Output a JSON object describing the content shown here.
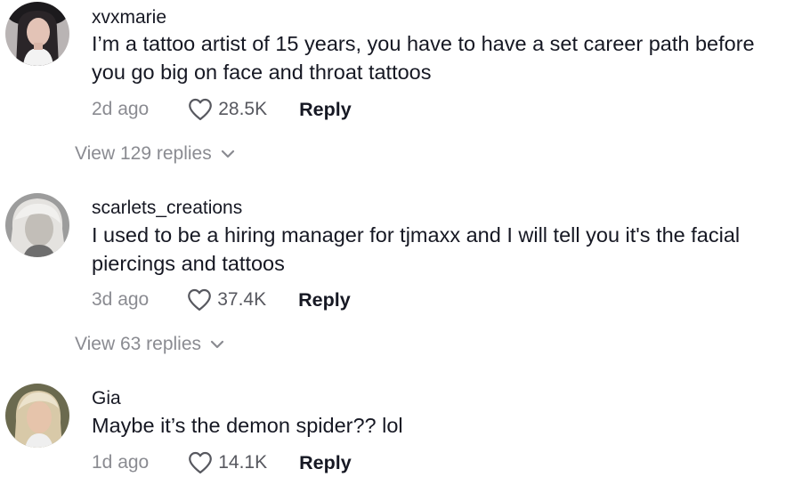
{
  "comments": [
    {
      "username": "xvxmarie",
      "text": "I’m a tattoo artist of 15 years, you have to have a set career path before you go big on face and throat tattoos",
      "time": "2d ago",
      "likes": "28.5K",
      "reply_label": "Reply",
      "view_replies": "View 129 replies"
    },
    {
      "username": "scarlets_creations",
      "text": "I used to be a hiring manager for tjmaxx and I will tell you it's the facial piercings and tattoos",
      "time": "3d ago",
      "likes": "37.4K",
      "reply_label": "Reply",
      "view_replies": "View 63 replies"
    },
    {
      "username": "Gia",
      "text": "Maybe it’s the demon spider?? lol",
      "time": "1d ago",
      "likes": "14.1K",
      "reply_label": "Reply"
    }
  ],
  "icons": {
    "like": "heart-outline-icon",
    "expand": "chevron-down-icon"
  },
  "colors": {
    "text_primary": "#161823",
    "text_secondary": "#8a8b91",
    "icon": "#57585f"
  }
}
